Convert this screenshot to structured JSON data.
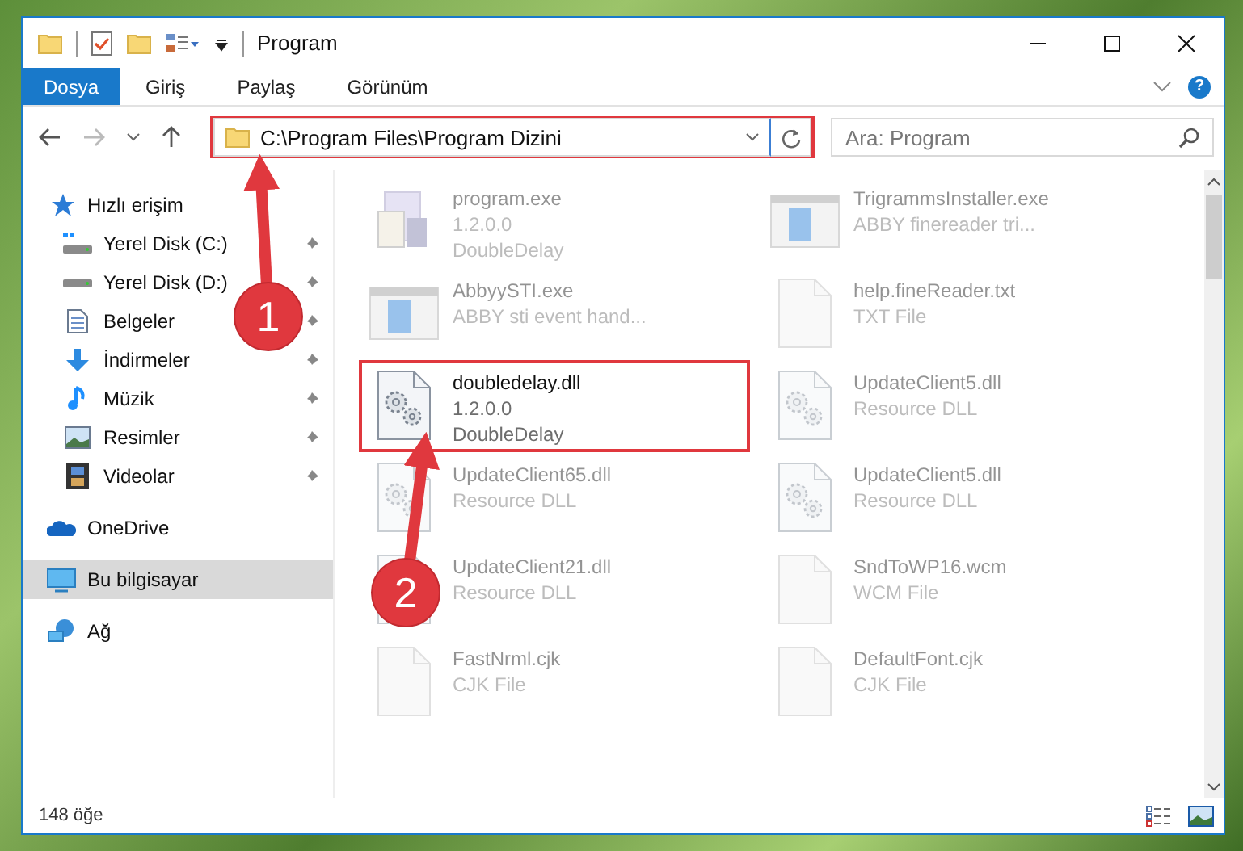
{
  "window": {
    "title": "Program"
  },
  "ribbon": {
    "tabs": [
      {
        "label": "Dosya",
        "selected": true
      },
      {
        "label": "Giriş",
        "selected": false
      },
      {
        "label": "Paylaş",
        "selected": false
      },
      {
        "label": "Görünüm",
        "selected": false
      }
    ],
    "help": "?"
  },
  "address": {
    "path": "C:\\Program Files\\Program Dizini",
    "highlighted": true
  },
  "search": {
    "placeholder": "Ara: Program"
  },
  "sidebar": {
    "items": [
      {
        "label": "Hızlı erişim",
        "selected": false,
        "children": [
          {
            "label": "Yerel Disk (C:)",
            "pinned": true
          },
          {
            "label": "Yerel Disk (D:)",
            "pinned": true
          },
          {
            "label": "Belgeler",
            "pinned": true
          },
          {
            "label": "İndirmeler",
            "pinned": true
          },
          {
            "label": "Müzik",
            "pinned": true
          },
          {
            "label": "Resimler",
            "pinned": true
          },
          {
            "label": "Videolar",
            "pinned": true
          }
        ]
      },
      {
        "label": "OneDrive",
        "selected": false
      },
      {
        "label": "Bu bilgisayar",
        "selected": true
      },
      {
        "label": "Ağ",
        "selected": false
      }
    ]
  },
  "files": [
    {
      "name": "program.exe",
      "lines": [
        "1.2.0.0",
        "DoubleDelay"
      ],
      "kind": "app",
      "highlighted": false,
      "dimmed": true
    },
    {
      "name": "TrigrammsInstaller.exe",
      "lines": [
        "ABBY finereader tri..."
      ],
      "kind": "window",
      "highlighted": false,
      "dimmed": true
    },
    {
      "name": "AbbyySTI.exe",
      "lines": [
        "ABBY sti event hand..."
      ],
      "kind": "window",
      "highlighted": false,
      "dimmed": true
    },
    {
      "name": "help.fineReader.txt",
      "lines": [
        "TXT File"
      ],
      "kind": "document",
      "highlighted": false,
      "dimmed": true
    },
    {
      "name": "doubledelay.dll",
      "lines": [
        "1.2.0.0",
        "DoubleDelay"
      ],
      "kind": "gears",
      "highlighted": true,
      "dimmed": false
    },
    {
      "name": "UpdateClient5.dll",
      "lines": [
        "Resource DLL"
      ],
      "kind": "gears",
      "highlighted": false,
      "dimmed": true
    },
    {
      "name": "UpdateClient65.dll",
      "lines": [
        "Resource DLL"
      ],
      "kind": "gears",
      "highlighted": false,
      "dimmed": true
    },
    {
      "name": "UpdateClient5.dll",
      "lines": [
        "Resource DLL"
      ],
      "kind": "gears",
      "highlighted": false,
      "dimmed": true
    },
    {
      "name": "UpdateClient21.dll",
      "lines": [
        "Resource DLL"
      ],
      "kind": "gears",
      "highlighted": false,
      "dimmed": true
    },
    {
      "name": "SndToWP16.wcm",
      "lines": [
        "WCM File"
      ],
      "kind": "document",
      "highlighted": false,
      "dimmed": true
    },
    {
      "name": "FastNrml.cjk",
      "lines": [
        "CJK File"
      ],
      "kind": "document",
      "highlighted": false,
      "dimmed": true
    },
    {
      "name": "DefaultFont.cjk",
      "lines": [
        "CJK File"
      ],
      "kind": "document",
      "highlighted": false,
      "dimmed": true
    }
  ],
  "status_bar": {
    "count": "148 öğe"
  },
  "callouts": [
    {
      "number": "1"
    },
    {
      "number": "2"
    }
  ]
}
